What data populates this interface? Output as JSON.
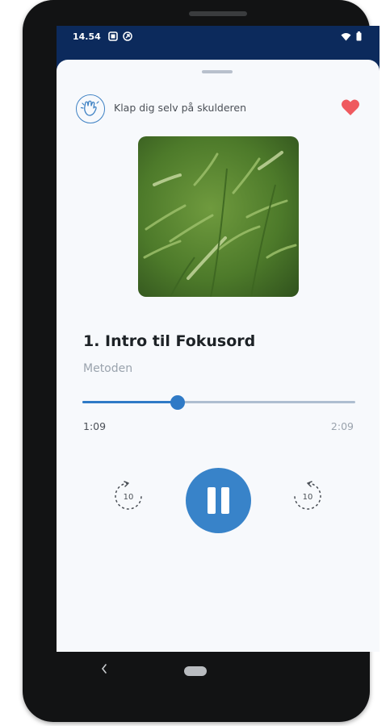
{
  "status_bar": {
    "time": "14.54",
    "icons": [
      "square-notification-icon",
      "vpn-key-icon",
      "wifi-icon",
      "battery-icon"
    ]
  },
  "header": {
    "title": "Klap dig selv på skulderen",
    "category_icon": "clapping-hands-icon",
    "favorite_icon": "heart-icon",
    "favorite_color": "#ef5a5f"
  },
  "cover": {
    "icon": "grass-photo"
  },
  "track": {
    "title": "1. Intro til Fokusord",
    "subtitle": "Metoden"
  },
  "player": {
    "current_time": "1:09",
    "total_time": "2:09",
    "progress": 0.35,
    "rewind_label": "10",
    "forward_label": "10",
    "play_state_icon": "pause-icon",
    "accent_color": "#3883c9"
  },
  "nav": {
    "back_icon": "nav-back-icon",
    "home_icon": "nav-home-pill"
  }
}
